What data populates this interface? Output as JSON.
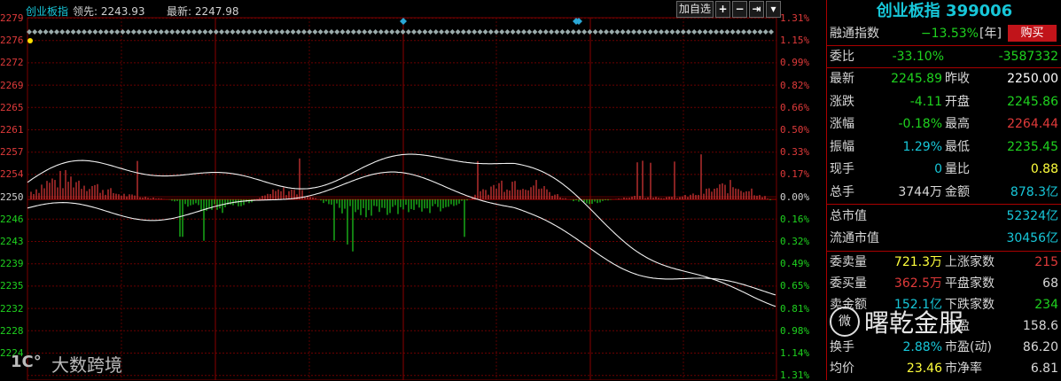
{
  "topbar": {
    "index_name": "创业板指",
    "lead_label": "领先:",
    "lead_value": "2243.93",
    "last_label": "最新:",
    "last_value": "2247.98",
    "add_button": "加自选",
    "btn_plus": "+",
    "btn_minus": "−",
    "btn_right": "⇥",
    "btn_menu": "▾"
  },
  "y_axis_left": [
    "2279",
    "2276",
    "2272",
    "2269",
    "2265",
    "2261",
    "2257",
    "2254",
    "2250",
    "2246",
    "2243",
    "2239",
    "2235",
    "2232",
    "2228",
    "2224"
  ],
  "y_axis_right": [
    "1.31%",
    "1.15%",
    "0.99%",
    "0.82%",
    "0.66%",
    "0.50%",
    "0.33%",
    "0.17%",
    "0.00%",
    "0.16%",
    "0.32%",
    "0.49%",
    "0.65%",
    "0.81%",
    "0.98%",
    "1.14%",
    "1.31%"
  ],
  "watermark_chart": {
    "icon": "1C°",
    "text": "大数跨境"
  },
  "watermark_panel": {
    "icon": "微",
    "text": "曙乾金服"
  },
  "colors": {
    "up": "#e03a3a",
    "down": "#1fd31f",
    "accent": "#17c7d9",
    "grid": "#7a0000"
  },
  "info": {
    "title": "创业板指 399006",
    "rz_label": "融通指数",
    "rz_value": "−13.53%",
    "rz_unit": "[年]",
    "buy": "购买",
    "wb_label": "委比",
    "wb_value": "-33.10%",
    "wb_diff": "-3587332",
    "rows": [
      {
        "l1": "最新",
        "v1": "2245.89",
        "l2": "昨收",
        "v2": "2250.00",
        "c1": "#1fd31f",
        "c2": "#ffffff"
      },
      {
        "l1": "涨跌",
        "v1": "-4.11",
        "l2": "开盘",
        "v2": "2245.86",
        "c1": "#1fd31f",
        "c2": "#1fd31f"
      },
      {
        "l1": "涨幅",
        "v1": "-0.18%",
        "l2": "最高",
        "v2": "2264.44",
        "c1": "#1fd31f",
        "c2": "#e03a3a"
      },
      {
        "l1": "振幅",
        "v1": "1.29%",
        "l2": "最低",
        "v2": "2235.45",
        "c1": "#17c7d9",
        "c2": "#1fd31f"
      },
      {
        "l1": "现手",
        "v1": "0",
        "l2": "量比",
        "v2": "0.88",
        "c1": "#17c7d9",
        "c2": "#ffff3c"
      },
      {
        "l1": "总手",
        "v1": "3744万",
        "l2": "金额",
        "v2": "878.3亿",
        "c1": "#d8d8d8",
        "c2": "#17c7d9"
      }
    ],
    "cap_rows": [
      {
        "l": "总市值",
        "v": "52324亿"
      },
      {
        "l": "流通市值",
        "v": "30456亿"
      }
    ],
    "bot_rows": [
      {
        "l1": "委卖量",
        "v1": "721.3万",
        "l2": "上涨家数",
        "v2": "215",
        "c1": "#ffff3c",
        "c2": "#e03a3a"
      },
      {
        "l1": "委买量",
        "v1": "362.5万",
        "l2": "平盘家数",
        "v2": "68",
        "c1": "#e03a3a",
        "c2": "#d8d8d8"
      },
      {
        "l1": "卖金额",
        "v1": "152.1亿",
        "l2": "下跌家数",
        "v2": "234",
        "c1": "#17c7d9",
        "c2": "#1fd31f"
      },
      {
        "l1": "",
        "v1": "",
        "l2": "市盈",
        "v2": "158.6",
        "c1": "#17c7d9",
        "c2": "#d8d8d8"
      },
      {
        "l1": "换手",
        "v1": "2.88%",
        "l2": "市盈(动)",
        "v2": "86.20",
        "c1": "#17c7d9",
        "c2": "#d8d8d8"
      },
      {
        "l1": "均价",
        "v1": "23.46",
        "l2": "市净率",
        "v2": "6.81",
        "c1": "#ffff3c",
        "c2": "#d8d8d8"
      }
    ]
  }
}
